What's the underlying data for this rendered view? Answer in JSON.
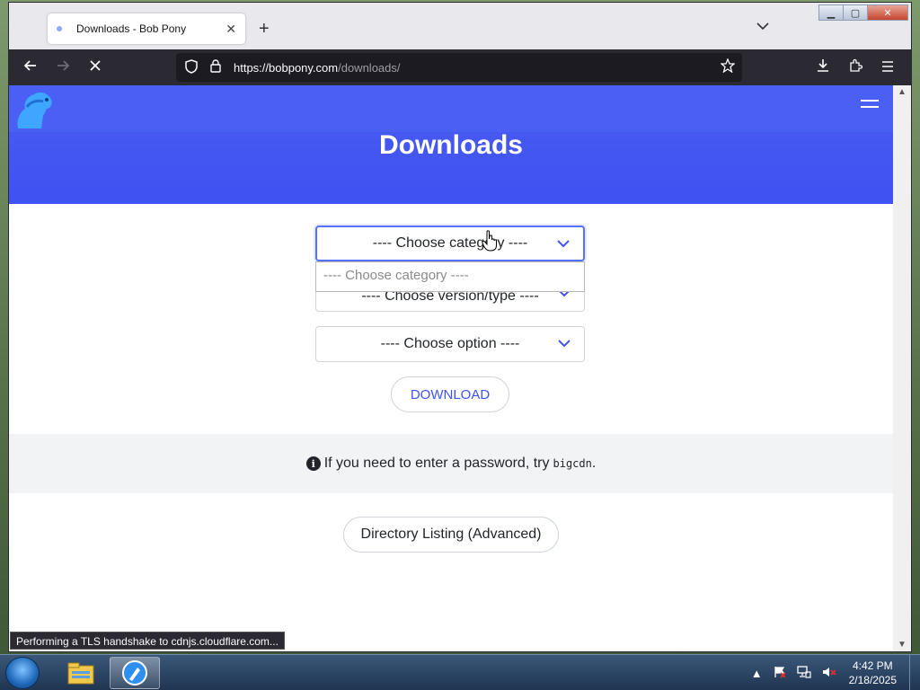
{
  "browser": {
    "tab_title": "Downloads - Bob Pony",
    "tab_close": "✕",
    "new_tab": "+",
    "url_host": "https://bobpony.com",
    "url_path": "/downloads/",
    "status_text": "Performing a TLS handshake to cdnjs.cloudflare.com..."
  },
  "page": {
    "title": "Downloads",
    "category_select": "---- Choose category ----",
    "category_dropdown_option": "---- Choose category ----",
    "version_select": "---- Choose version/type ----",
    "option_select": "---- Choose option ----",
    "download_button": "DOWNLOAD",
    "notice_text": "If you need to enter a password, try",
    "notice_code": "bigcdn",
    "notice_end": ".",
    "directory_button": "Directory Listing (Advanced)"
  },
  "taskbar": {
    "time": "4:42 PM",
    "date": "2/18/2025"
  },
  "colors": {
    "accent": "#3f52f2",
    "toolbar": "#2b2a33"
  },
  "icons": [
    "back-arrow-icon",
    "forward-arrow-icon",
    "stop-icon",
    "shield-icon",
    "lock-icon",
    "star-icon",
    "download-icon",
    "extensions-icon",
    "menu-icon",
    "info-icon",
    "chevron-down-icon",
    "hamburger-icon",
    "logo-icon"
  ]
}
